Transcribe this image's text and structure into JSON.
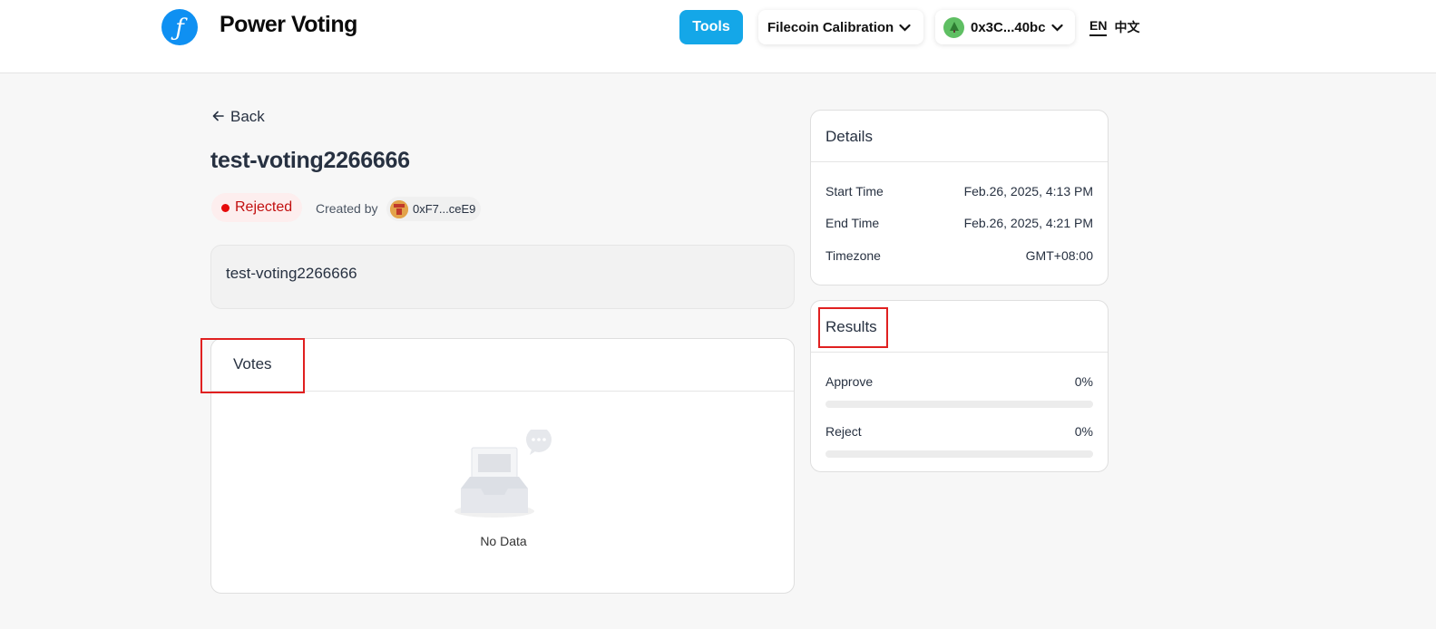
{
  "header": {
    "app_title": "Power Voting",
    "tools_label": "Tools",
    "network_label": "Filecoin Calibration",
    "wallet_label": "0x3C...40bc",
    "lang_en": "EN",
    "lang_zh": "中文"
  },
  "proposal": {
    "back_label": "Back",
    "title": "test-voting2266666",
    "status": "Rejected",
    "created_by_label": "Created by",
    "creator": "0xF7...ceE9",
    "description": "test-voting2266666"
  },
  "votes": {
    "title": "Votes",
    "empty_text": "No Data"
  },
  "details": {
    "title": "Details",
    "rows": [
      {
        "label": "Start Time",
        "value": "Feb.26, 2025, 4:13 PM"
      },
      {
        "label": "End Time",
        "value": "Feb.26, 2025, 4:21 PM"
      },
      {
        "label": "Timezone",
        "value": "GMT+08:00"
      }
    ]
  },
  "results": {
    "title": "Results",
    "options": [
      {
        "label": "Approve",
        "value": "0%",
        "fraction": 0
      },
      {
        "label": "Reject",
        "value": "0%",
        "fraction": 0
      }
    ]
  },
  "colors": {
    "accent": "#14a7e8",
    "logo": "#0f90f2",
    "rejected": "#e60a0a",
    "highlight": "#e02020"
  },
  "icons": [
    "filecoin-logo-icon",
    "chevron-down-icon",
    "wallet-avatar-icon",
    "arrow-left-icon",
    "creator-avatar-icon",
    "empty-inbox-icon"
  ]
}
